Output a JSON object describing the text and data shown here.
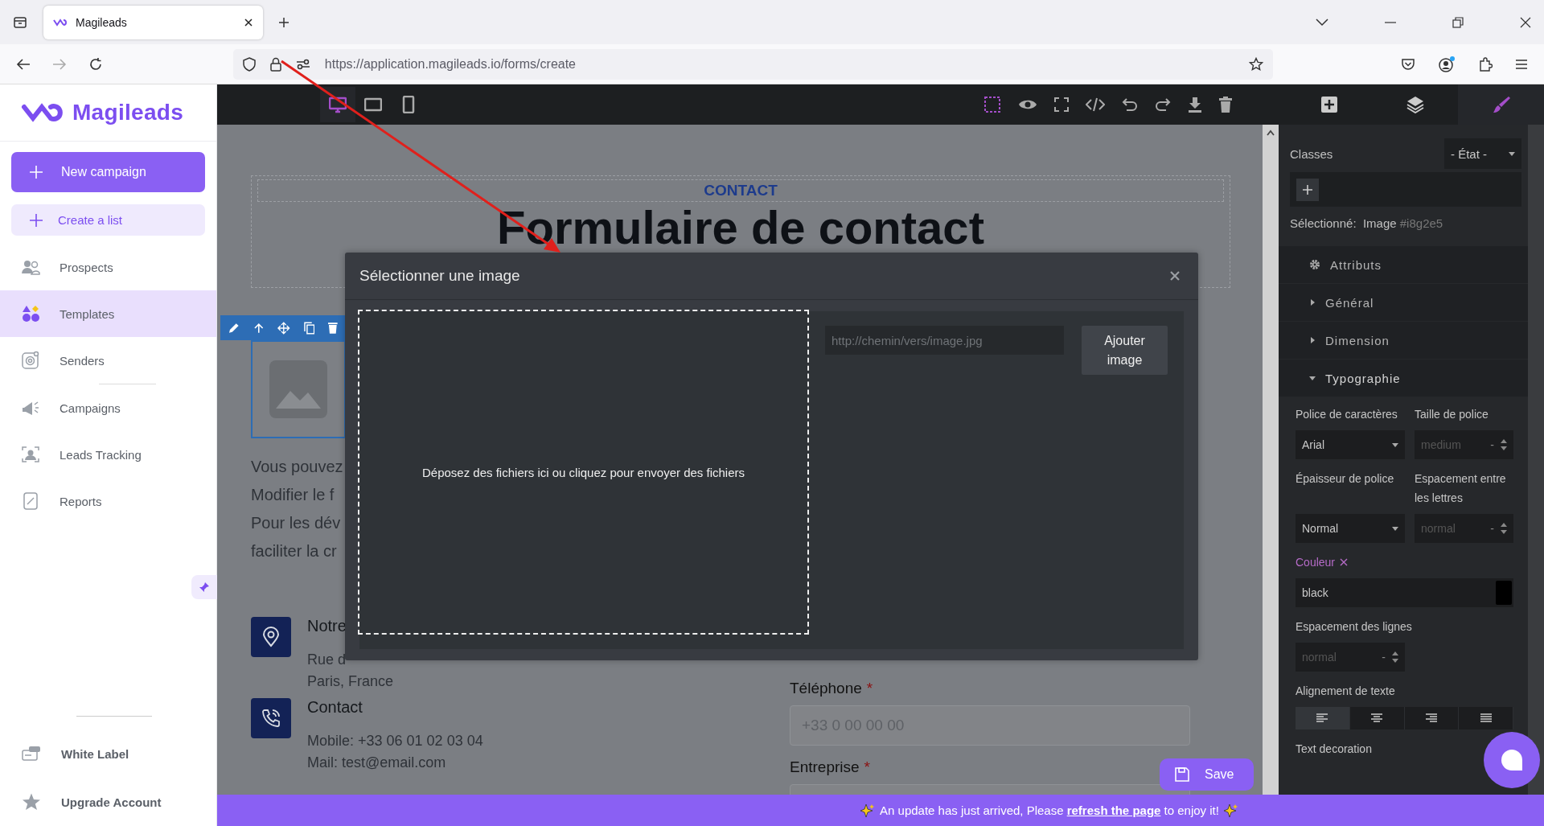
{
  "browser": {
    "tab_title": "Magileads",
    "url": "https://application.magileads.io/forms/create"
  },
  "sidebar": {
    "logo": "Magileads",
    "new_campaign": "New campaign",
    "create_list": "Create a list",
    "items": [
      {
        "label": "Prospects",
        "selected": false
      },
      {
        "label": "Templates",
        "selected": true
      },
      {
        "label": "Senders",
        "selected": false
      },
      {
        "label": "Campaigns",
        "selected": false
      },
      {
        "label": "Leads Tracking",
        "selected": false
      },
      {
        "label": "Reports",
        "selected": false
      }
    ],
    "bottom_items": [
      {
        "label": "White Label"
      },
      {
        "label": "Upgrade Account"
      }
    ]
  },
  "editor": {
    "devices": [
      {
        "selected": true
      },
      {
        "selected": false
      },
      {
        "selected": false
      }
    ],
    "panel_tabs": [
      {
        "selected": false
      },
      {
        "selected": false
      },
      {
        "selected": true
      }
    ]
  },
  "canvas": {
    "eyebrow": "CONTACT",
    "title": "Formulaire de contact",
    "paragraph_lines": [
      "Vous pouvez",
      "Modifier le f",
      "Pour les dév",
      "faciliter la cr"
    ],
    "address": {
      "heading": "Notre",
      "lines": [
        "Rue d",
        "Paris, France"
      ]
    },
    "contact": {
      "heading": "Contact",
      "lines": [
        "Mobile: +33 06 01 02 03 04",
        "Mail: test@email.com"
      ]
    },
    "form_fields": [
      {
        "label": "Téléphone",
        "required_mark": "*",
        "placeholder": "+33 0 00 00 00"
      },
      {
        "label": "Entreprise",
        "required_mark": "*"
      }
    ],
    "save_button": "Save"
  },
  "modal": {
    "title": "Sélectionner une image",
    "dropzone": "Déposez des fichiers ici ou cliquez pour envoyer des fichiers",
    "url_placeholder": "http://chemin/vers/image.jpg",
    "add_button": "Ajouter image"
  },
  "panel": {
    "classes_label": "Classes",
    "state_select": "- État -",
    "selected_label": "Sélectionné:",
    "selected_type": "Image",
    "selected_id": "#i8g2e5",
    "sections": [
      {
        "label": "Attributs",
        "kind": "attributes",
        "expanded": false
      },
      {
        "label": "Général",
        "kind": "group",
        "expanded": false
      },
      {
        "label": "Dimension",
        "kind": "group",
        "expanded": false
      },
      {
        "label": "Typographie",
        "kind": "group",
        "expanded": true
      }
    ],
    "properties": [
      {
        "label": "Police de caractères",
        "kind": "select",
        "value": "Arial"
      },
      {
        "label": "Taille de police",
        "kind": "number",
        "placeholder": "medium",
        "unit": "-"
      },
      {
        "label": "Épaisseur de police",
        "kind": "select",
        "value": "Normal"
      },
      {
        "label": "Espacement entre les lettres",
        "kind": "number",
        "placeholder": "normal",
        "unit": "-"
      },
      {
        "label": "Couleur",
        "kind": "color",
        "modified": true,
        "value": "black"
      },
      {
        "label": "Espacement des lignes",
        "kind": "number",
        "placeholder": "normal",
        "unit": "-"
      },
      {
        "label": "Alignement de texte",
        "kind": "align",
        "options": [
          {
            "selected": true
          },
          {
            "selected": false
          },
          {
            "selected": false
          },
          {
            "selected": false
          }
        ]
      },
      {
        "label": "Text decoration",
        "kind": "text"
      }
    ]
  },
  "banner": {
    "text_before": "An update has just arrived, Please ",
    "link": "refresh the page",
    "text_after": " to enjoy it!"
  }
}
